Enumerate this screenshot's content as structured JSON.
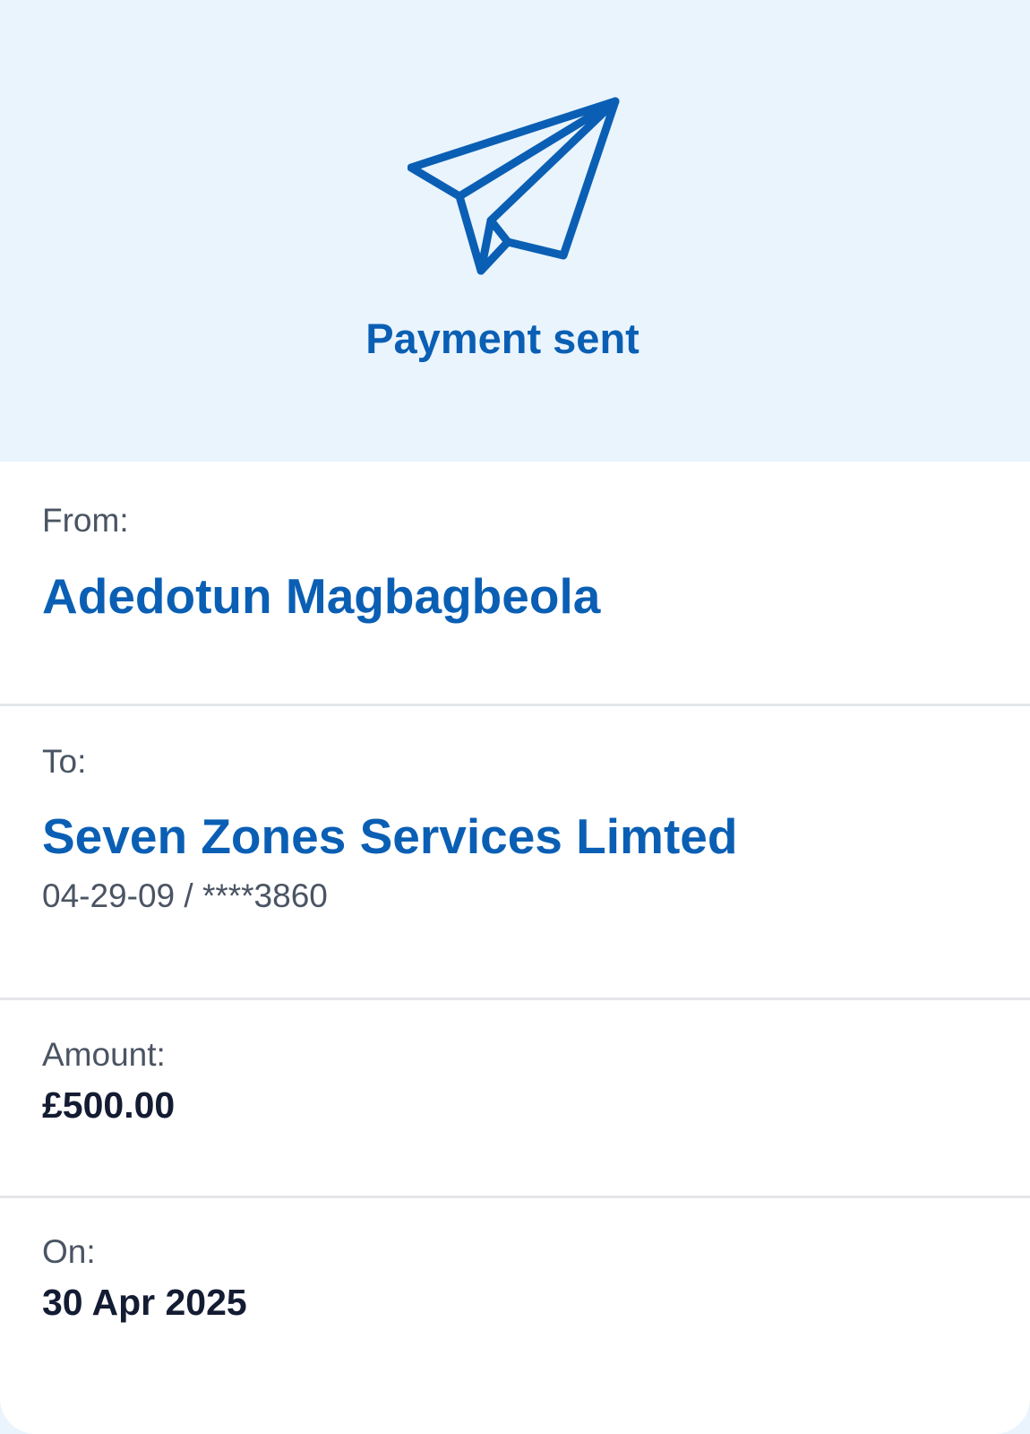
{
  "header": {
    "icon": "paper-plane-icon",
    "title": "Payment sent"
  },
  "details": {
    "from": {
      "label": "From:",
      "value": "Adedotun Magbagbeola"
    },
    "to": {
      "label": "To:",
      "value": "Seven Zones Services Limted",
      "account": "04-29-09 / ****3860"
    },
    "amount": {
      "label": "Amount:",
      "value": "£500.00"
    },
    "date": {
      "label": "On:",
      "value": "30 Apr 2025"
    }
  },
  "colors": {
    "accent": "#0a5fb4",
    "hero_background": "#eaf4fd",
    "label_text": "#4a5463",
    "value_text": "#141c33"
  }
}
